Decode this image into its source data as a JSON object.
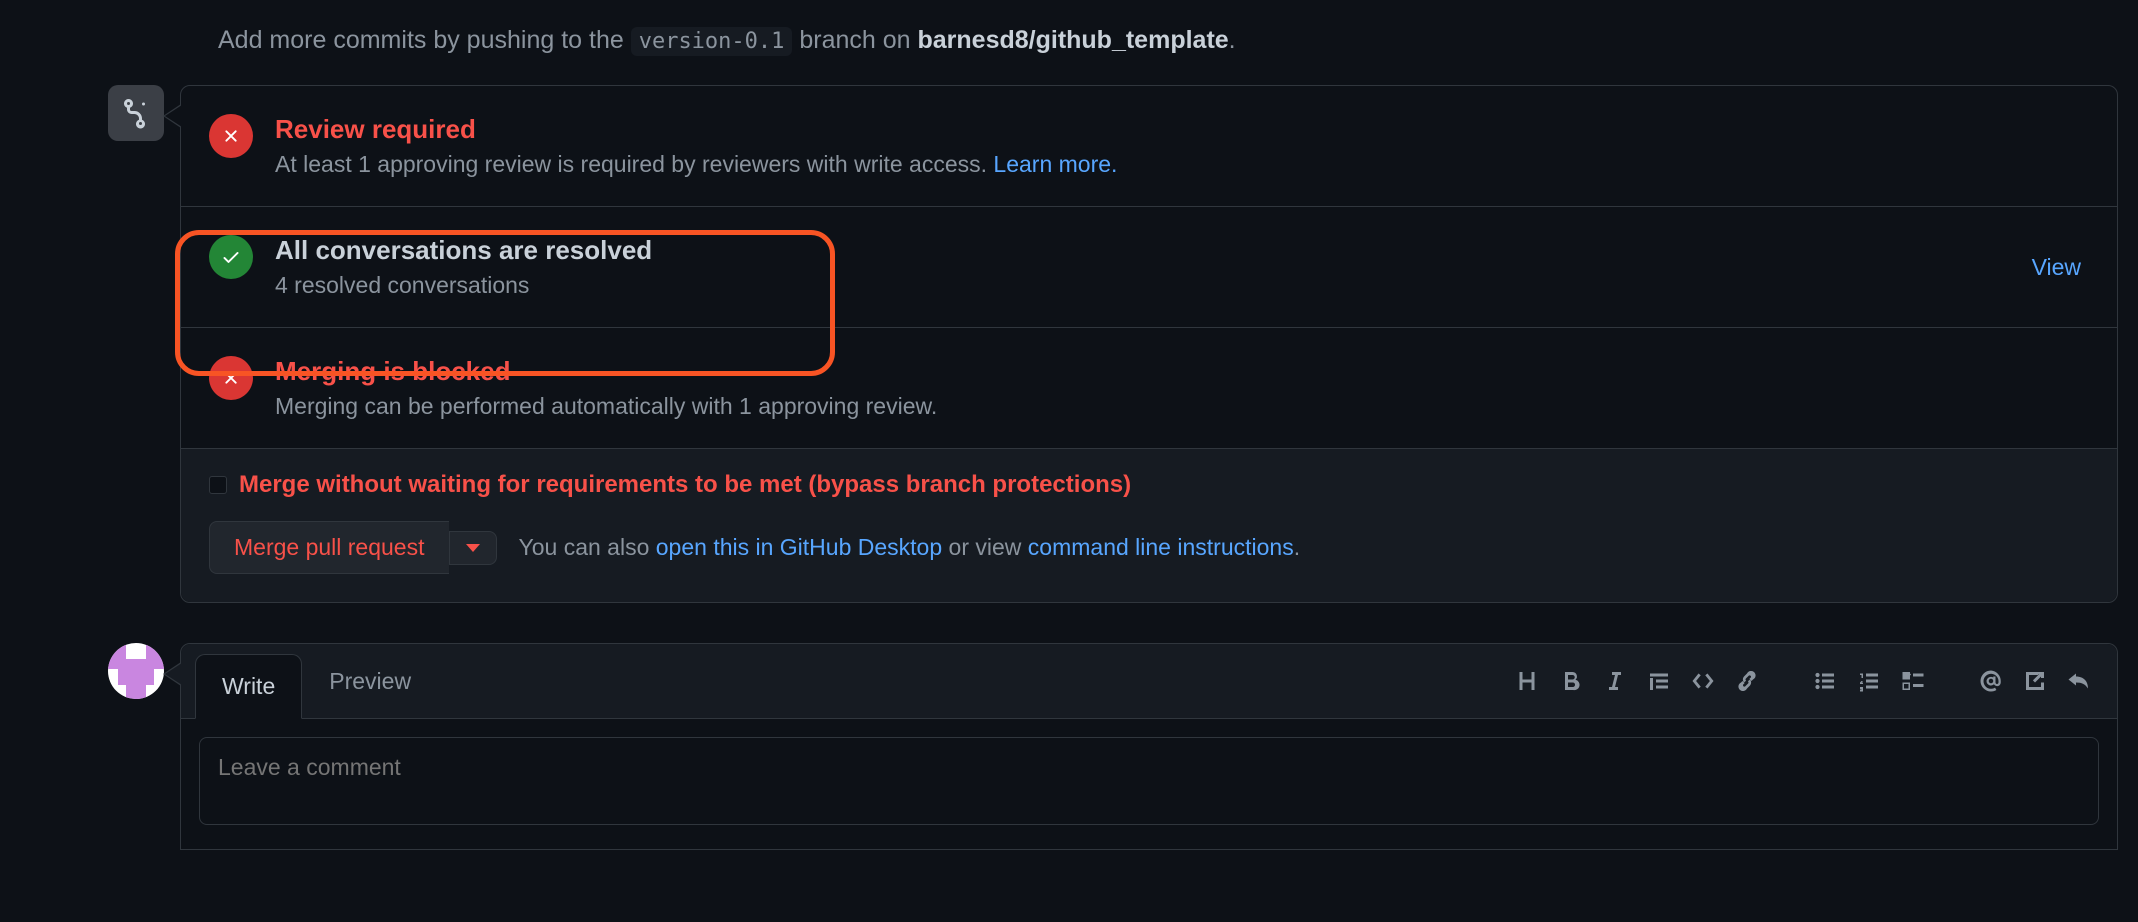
{
  "hint": {
    "prefix": "Add more commits by pushing to the ",
    "branch": "version-0.1",
    "middle": " branch on ",
    "repo": "barnesd8/github_template",
    "suffix": "."
  },
  "statuses": {
    "review": {
      "title": "Review required",
      "desc_prefix": "At least 1 approving review is required by reviewers with write access. ",
      "learn_more": "Learn more."
    },
    "resolved": {
      "title": "All conversations are resolved",
      "desc": "4 resolved conversations",
      "view": "View"
    },
    "blocked": {
      "title": "Merging is blocked",
      "desc": "Merging can be performed automatically with 1 approving review."
    }
  },
  "footer": {
    "bypass_label": "Merge without waiting for requirements to be met (bypass branch protections)",
    "merge_btn": "Merge pull request",
    "also_prefix": "You can also ",
    "open_desktop": "open this in GitHub Desktop",
    "or_view": " or view ",
    "cli": "command line instructions",
    "period": "."
  },
  "comment": {
    "tab_write": "Write",
    "tab_preview": "Preview",
    "placeholder": "Leave a comment"
  }
}
